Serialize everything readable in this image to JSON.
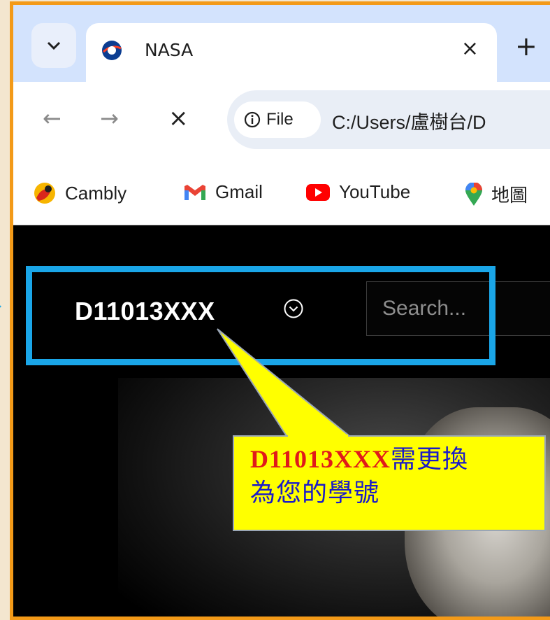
{
  "browser": {
    "tab": {
      "title": "NASA",
      "close": "×"
    },
    "new_tab": "+",
    "nav": {
      "back": "←",
      "forward": "→",
      "stop": "×"
    },
    "omnibox": {
      "chip_label": "File",
      "url": "C:/Users/盧樹台/D"
    },
    "bookmarks": [
      {
        "label": "Cambly",
        "icon": "cambly-icon"
      },
      {
        "label": "Gmail",
        "icon": "gmail-icon"
      },
      {
        "label": "YouTube",
        "icon": "youtube-icon"
      },
      {
        "label": "地圖",
        "icon": "maps-icon"
      }
    ]
  },
  "page": {
    "brand": "D11013XXX",
    "search_placeholder": "Search..."
  },
  "annotation": {
    "id_text": "D11013XXX",
    "line1_rest": "需更換",
    "line2": "為您的學號"
  },
  "colors": {
    "frame": "#f39a18",
    "highlight": "#1aa6e8",
    "callout_fill": "#ffff00",
    "callout_text": "#1a1ac8",
    "callout_id": "#e01a1a"
  }
}
